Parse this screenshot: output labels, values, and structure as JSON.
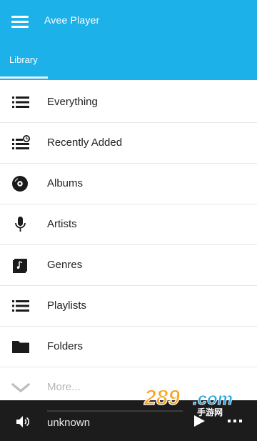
{
  "app": {
    "title": "Avee Player"
  },
  "tabs": [
    {
      "label": "Library"
    }
  ],
  "library": {
    "items": [
      {
        "label": "Everything",
        "icon": "list-icon"
      },
      {
        "label": "Recently Added",
        "icon": "recently-added-icon"
      },
      {
        "label": "Albums",
        "icon": "disc-icon"
      },
      {
        "label": "Artists",
        "icon": "microphone-icon"
      },
      {
        "label": "Genres",
        "icon": "music-note-icon"
      },
      {
        "label": "Playlists",
        "icon": "playlist-icon"
      },
      {
        "label": "Folders",
        "icon": "folder-icon"
      },
      {
        "label": "More...",
        "icon": "chevron-down-icon"
      }
    ]
  },
  "player": {
    "song": "unknown"
  },
  "watermark": {
    "text": "289.com",
    "sub": "手游网"
  },
  "colors": {
    "accent": "#1db1e9",
    "player_bg": "#1c1c1c"
  }
}
